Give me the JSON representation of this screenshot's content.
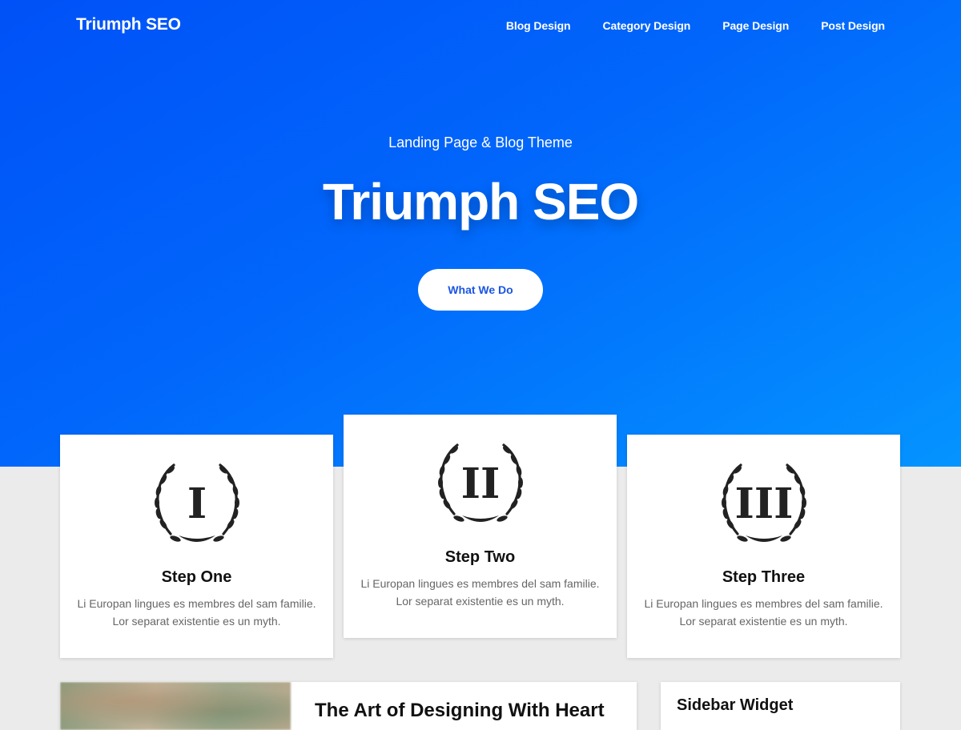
{
  "header": {
    "site_title": "Triumph SEO",
    "nav": [
      {
        "label": "Blog Design"
      },
      {
        "label": "Category Design"
      },
      {
        "label": "Page Design"
      },
      {
        "label": "Post Design"
      }
    ]
  },
  "hero": {
    "subtitle": "Landing Page & Blog Theme",
    "title": "Triumph SEO",
    "button_label": "What We Do",
    "gradient_start": "#0051f7",
    "gradient_end": "#0494ff",
    "button_text_color": "#1a55e3"
  },
  "steps": [
    {
      "numeral": "I",
      "icon": "laurel-wreath-icon",
      "title": "Step One",
      "text": "Li Europan lingues es membres del sam familie. Lor separat existentie es un myth."
    },
    {
      "numeral": "II",
      "icon": "laurel-wreath-icon",
      "title": "Step Two",
      "text": "Li Europan lingues es membres del sam familie. Lor separat existentie es un myth."
    },
    {
      "numeral": "III",
      "icon": "laurel-wreath-icon",
      "title": "Step Three",
      "text": "Li Europan lingues es membres del sam familie. Lor separat existentie es un myth."
    }
  ],
  "post": {
    "title": "The Art of Designing With Heart"
  },
  "sidebar": {
    "widget_title": "Sidebar Widget"
  }
}
